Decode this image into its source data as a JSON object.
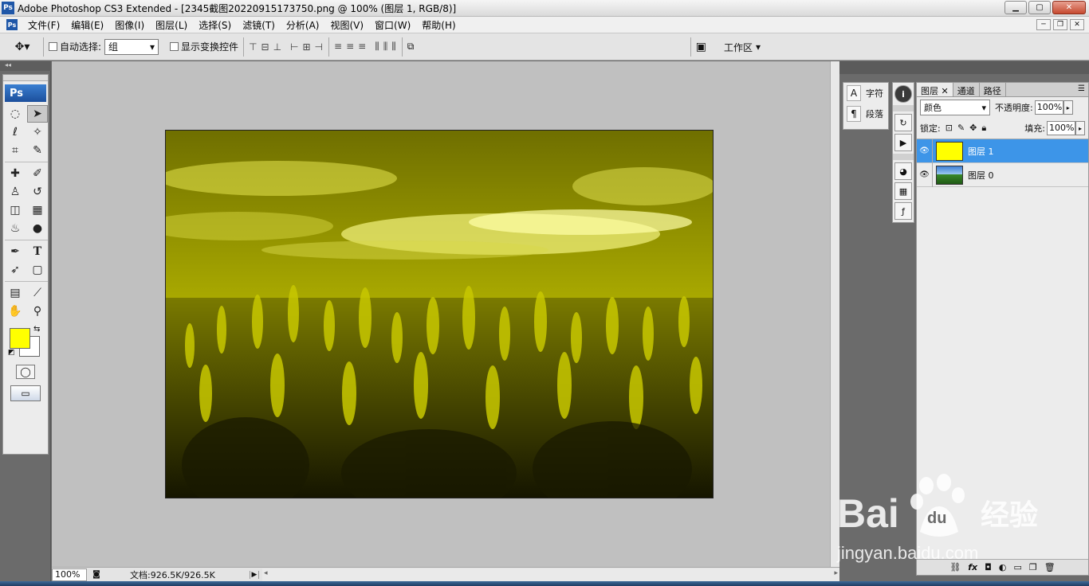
{
  "window": {
    "title": "Adobe Photoshop CS3 Extended - [2345截图20220915173750.png @ 100% (图层 1, RGB/8)]",
    "logo": "Ps"
  },
  "menu": {
    "logo": "Ps",
    "items": [
      "文件(F)",
      "编辑(E)",
      "图像(I)",
      "图层(L)",
      "选择(S)",
      "滤镜(T)",
      "分析(A)",
      "视图(V)",
      "窗口(W)",
      "帮助(H)"
    ]
  },
  "options": {
    "auto_select_label": "自动选择:",
    "auto_select_value": "组",
    "show_transform_label": "显示变换控件",
    "workspace_label": "工作区"
  },
  "toolbox": {
    "logo": "Ps",
    "foreground_color": "#ffff00",
    "background_color": "#ffffff"
  },
  "status": {
    "zoom": "100%",
    "doc_size": "文档:926.5K/926.5K"
  },
  "char_panel": {
    "character_label": "字符",
    "paragraph_label": "段落"
  },
  "layers_panel": {
    "tabs": [
      "图层",
      "通道",
      "路径"
    ],
    "blend_mode": "颜色",
    "opacity_label": "不透明度:",
    "opacity_value": "100%",
    "lock_label": "锁定:",
    "fill_label": "填充:",
    "fill_value": "100%",
    "layers": [
      {
        "name": "图层 1",
        "selected": true
      },
      {
        "name": "图层 0",
        "selected": false
      }
    ]
  },
  "watermark": {
    "brand": "Bai",
    "brand2": "du",
    "product": "经验",
    "url": "jingyan.baidu.com"
  },
  "colors": {
    "accent_selection": "#3d95e8",
    "image_tint": "#d4d400"
  }
}
